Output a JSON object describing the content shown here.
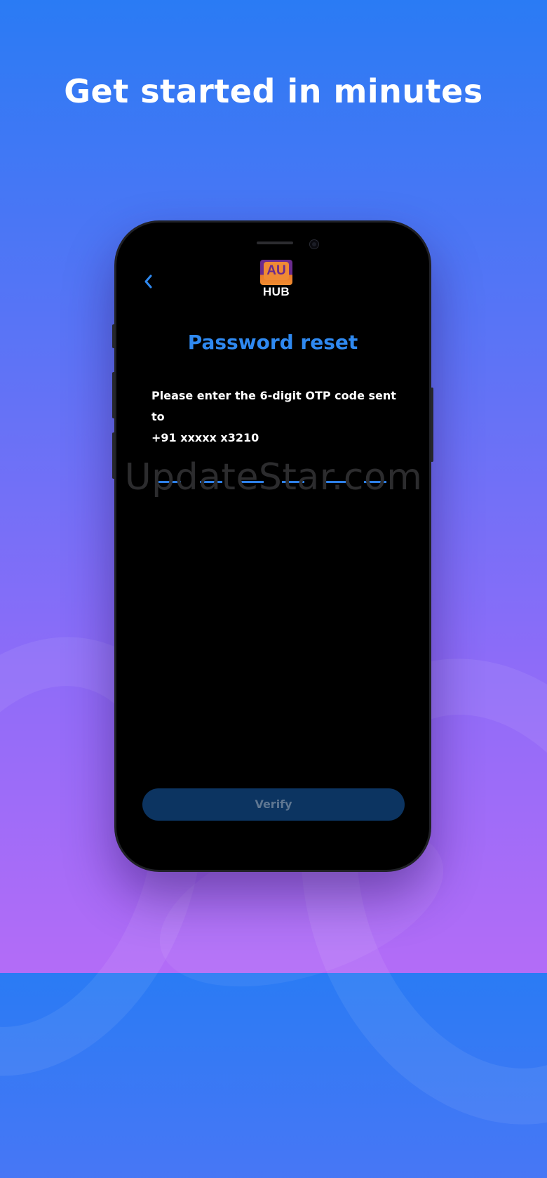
{
  "headline": "Get started in minutes",
  "app": {
    "logo_text": "AU",
    "logo_subtext": "HUB"
  },
  "screen": {
    "title": "Password reset",
    "instruction_line1": "Please enter the 6-digit OTP code sent to",
    "instruction_line2": "+91 xxxxx x3210",
    "otp_length": 6,
    "otp_values": [
      "",
      "",
      "",
      "",
      "",
      ""
    ],
    "verify_label": "Verify"
  },
  "watermark": "UpdateStar.com",
  "colors": {
    "background_top": "#2a7bf4",
    "background_bottom": "#b36cf7",
    "accent": "#2f89f0",
    "button_disabled": "#0c3461",
    "logo_purple": "#6a2a8c",
    "logo_orange": "#ef8a34"
  },
  "icons": {
    "back": "chevron-left-icon"
  }
}
